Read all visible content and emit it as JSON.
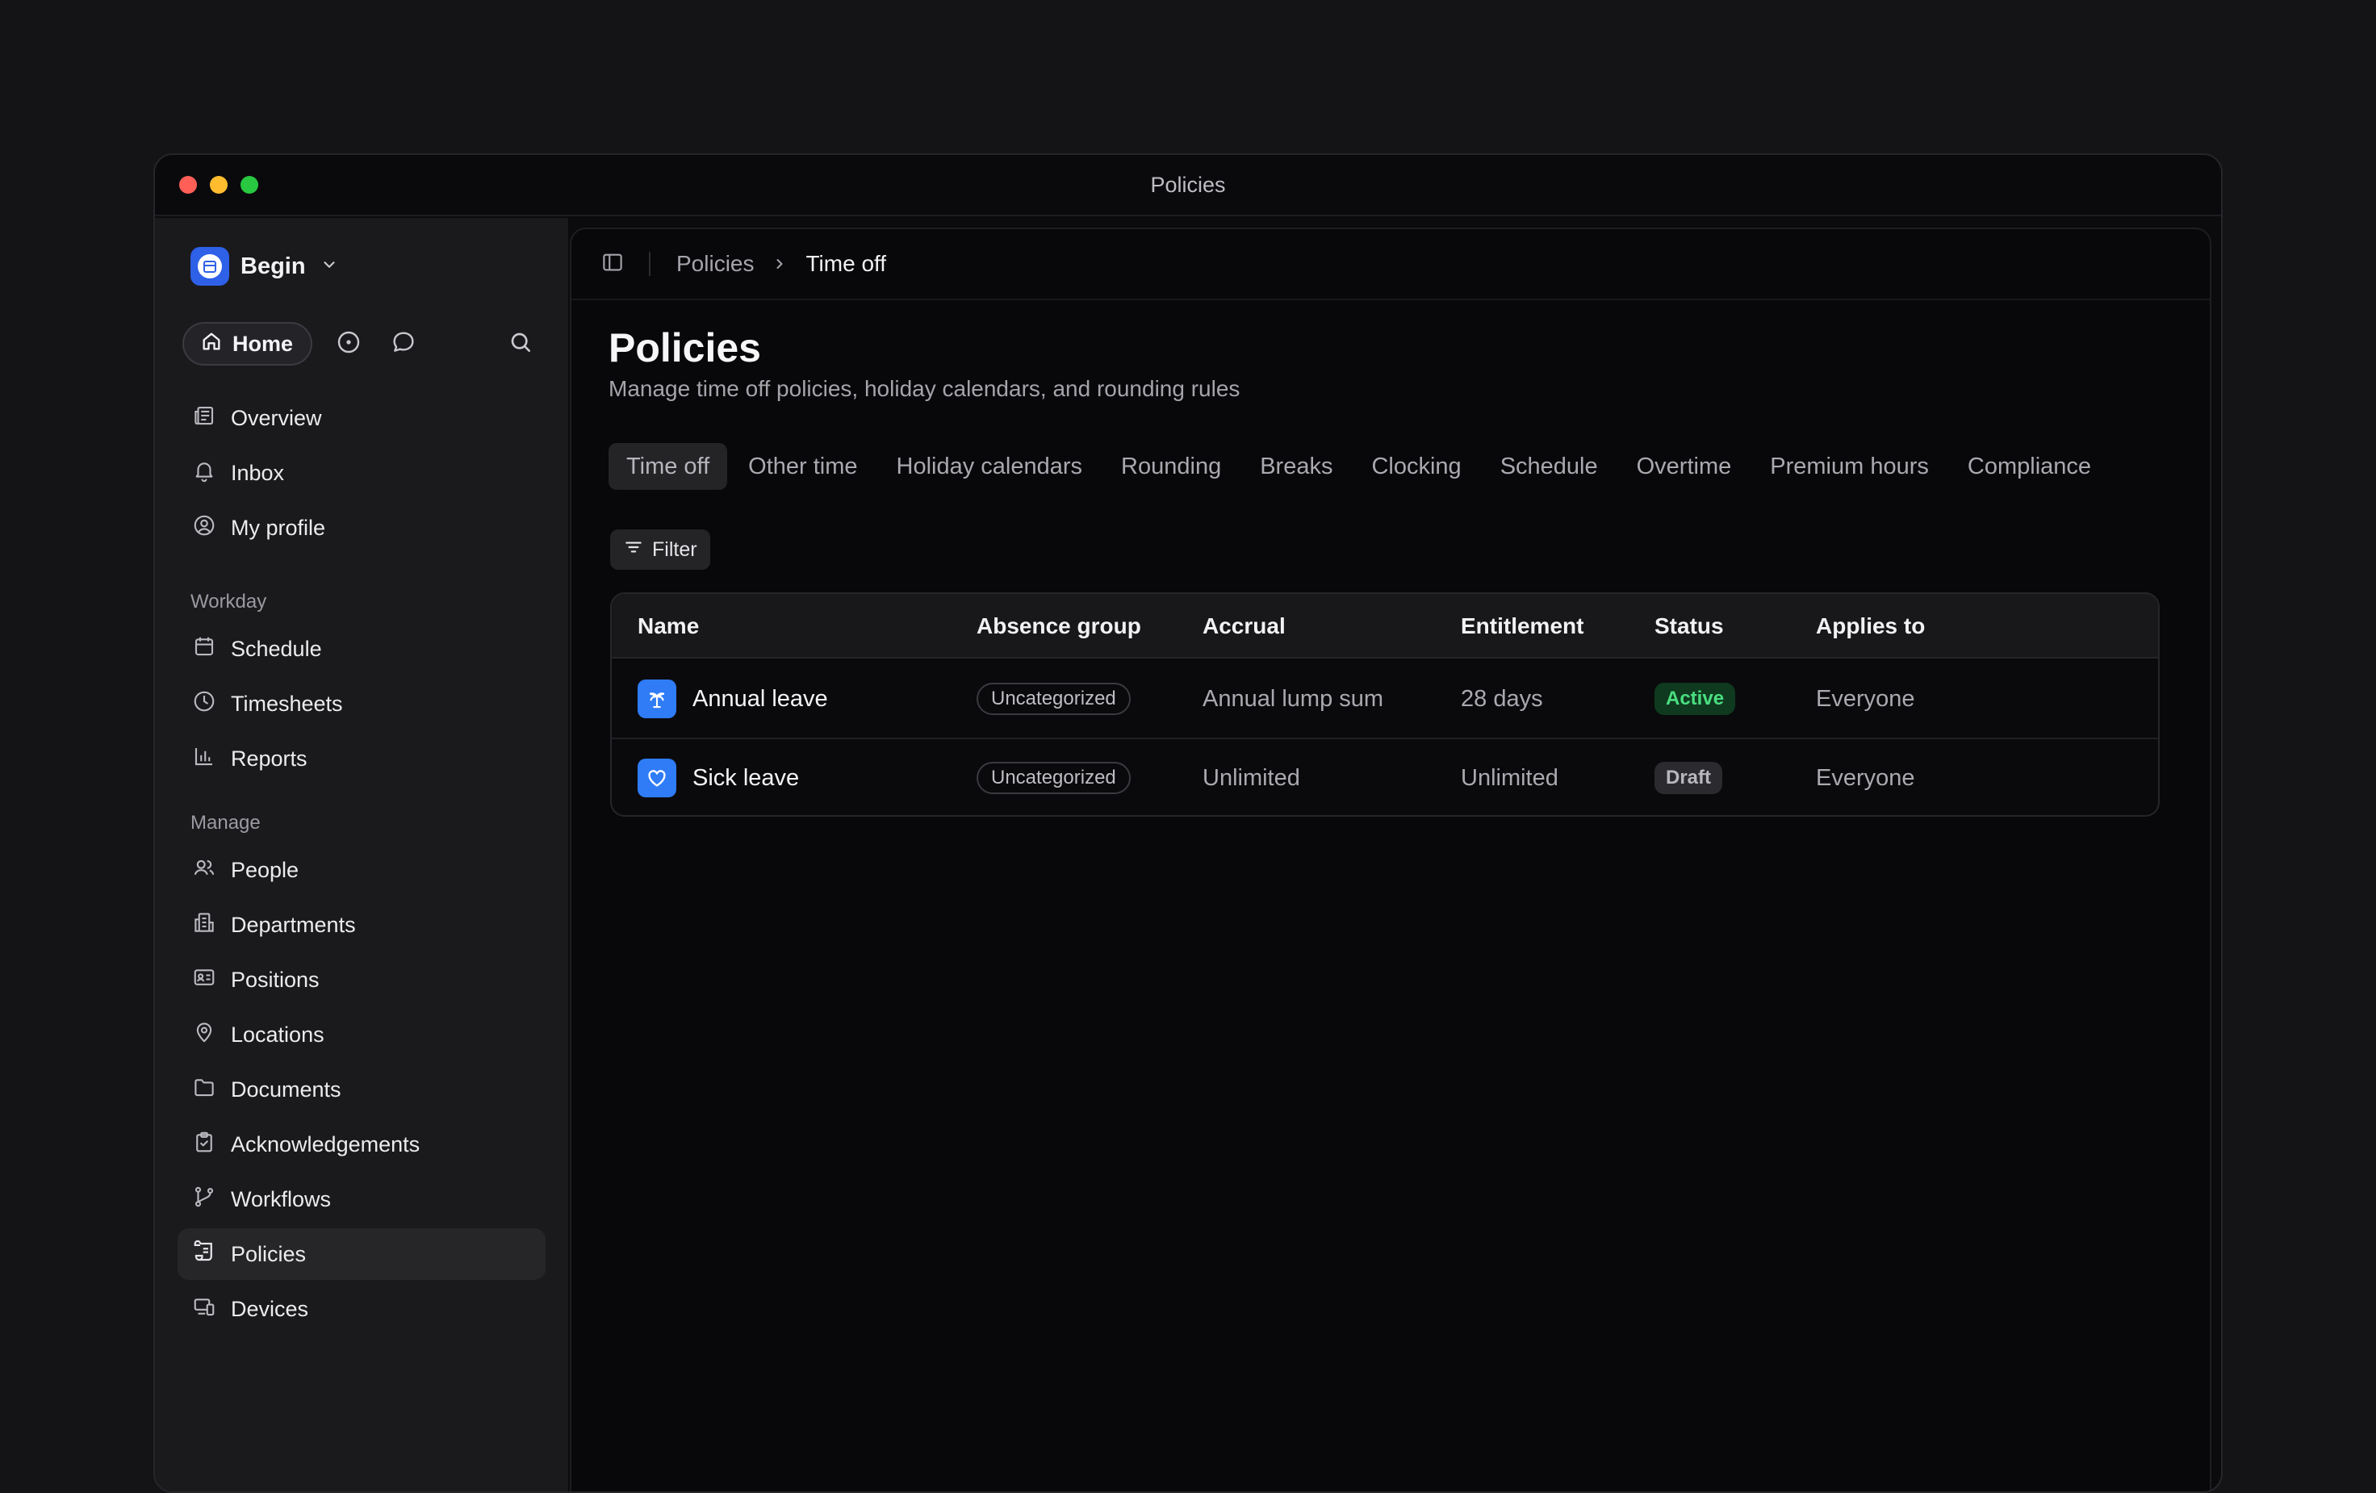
{
  "window": {
    "title": "Policies"
  },
  "sidebar": {
    "workspace": {
      "name": "Begin"
    },
    "home_label": "Home",
    "primary": [
      {
        "label": "Overview",
        "icon": "newspaper-icon"
      },
      {
        "label": "Inbox",
        "icon": "bell-icon"
      },
      {
        "label": "My profile",
        "icon": "user-circle-icon"
      }
    ],
    "sections": [
      {
        "title": "Workday",
        "items": [
          {
            "label": "Schedule",
            "icon": "calendar-icon"
          },
          {
            "label": "Timesheets",
            "icon": "clock-icon"
          },
          {
            "label": "Reports",
            "icon": "bar-chart-icon"
          }
        ]
      },
      {
        "title": "Manage",
        "items": [
          {
            "label": "People",
            "icon": "users-icon"
          },
          {
            "label": "Departments",
            "icon": "building-icon"
          },
          {
            "label": "Positions",
            "icon": "id-card-icon"
          },
          {
            "label": "Locations",
            "icon": "map-pin-icon"
          },
          {
            "label": "Documents",
            "icon": "folder-icon"
          },
          {
            "label": "Acknowledgements",
            "icon": "clipboard-check-icon"
          },
          {
            "label": "Workflows",
            "icon": "git-branch-icon"
          },
          {
            "label": "Policies",
            "icon": "scroll-icon",
            "active": true
          },
          {
            "label": "Devices",
            "icon": "devices-icon"
          }
        ]
      }
    ]
  },
  "breadcrumb": {
    "parent": "Policies",
    "current": "Time off"
  },
  "page": {
    "title": "Policies",
    "subtitle": "Manage time off policies, holiday calendars, and rounding rules"
  },
  "tabs": [
    {
      "label": "Time off",
      "active": true
    },
    {
      "label": "Other time"
    },
    {
      "label": "Holiday calendars"
    },
    {
      "label": "Rounding"
    },
    {
      "label": "Breaks"
    },
    {
      "label": "Clocking"
    },
    {
      "label": "Schedule"
    },
    {
      "label": "Overtime"
    },
    {
      "label": "Premium hours"
    },
    {
      "label": "Compliance"
    }
  ],
  "filter_label": "Filter",
  "table": {
    "columns": [
      "Name",
      "Absence group",
      "Accrual",
      "Entitlement",
      "Status",
      "Applies to"
    ],
    "rows": [
      {
        "icon": "palm-tree-icon",
        "name": "Annual leave",
        "group": "Uncategorized",
        "accrual": "Annual lump sum",
        "entitlement": "28 days",
        "status": "Active",
        "applies_to": "Everyone"
      },
      {
        "icon": "heart-icon",
        "name": "Sick leave",
        "group": "Uncategorized",
        "accrual": "Unlimited",
        "entitlement": "Unlimited",
        "status": "Draft",
        "applies_to": "Everyone"
      }
    ]
  },
  "colors": {
    "accent": "#2f7cf6",
    "active_badge_text": "#4ade80",
    "active_badge_bg": "#0f3a1f"
  }
}
